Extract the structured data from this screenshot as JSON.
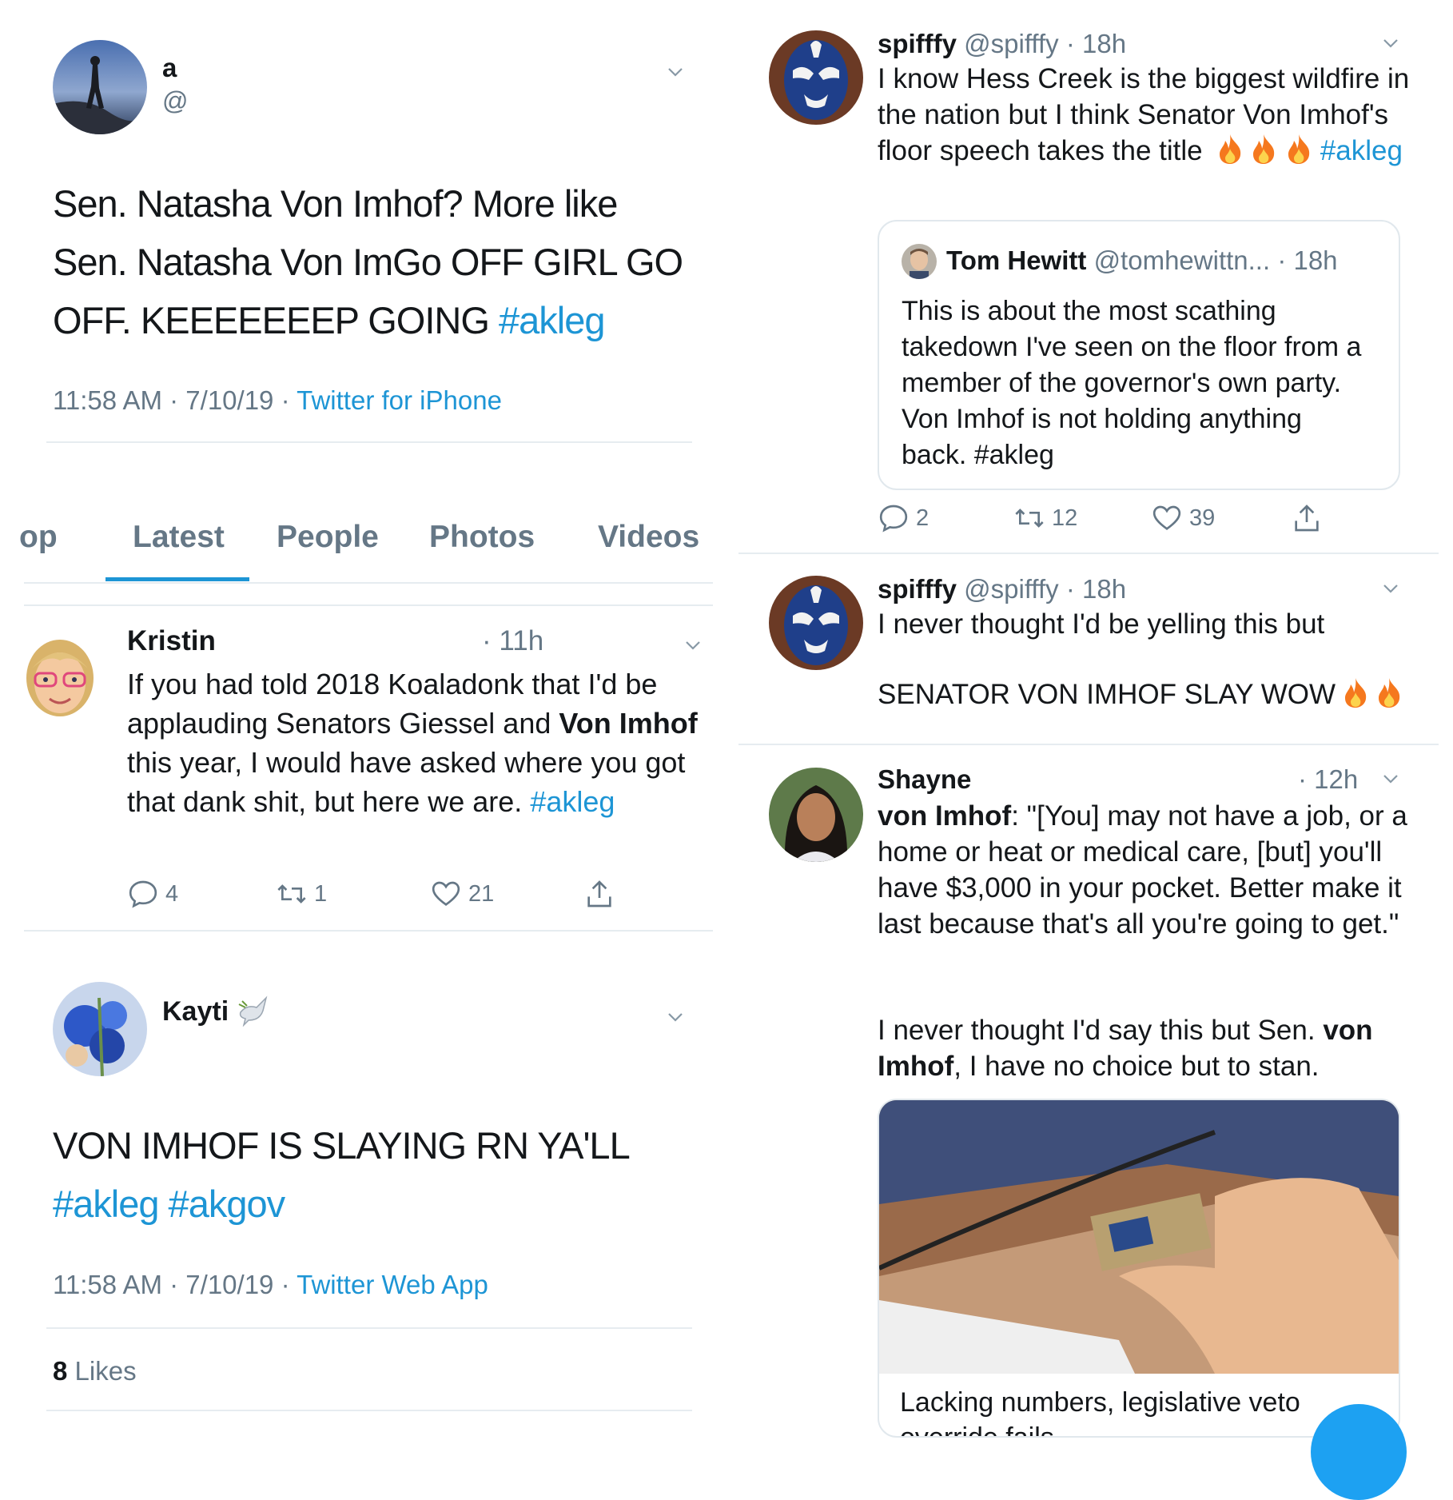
{
  "tweet1": {
    "name": "a",
    "handle": "@",
    "text": "Sen. Natasha Von Imhof? More like Sen. Natasha Von ImGo OFF GIRL GO OFF. KEEEEEEEP GOING",
    "hashtag": "#akleg",
    "time": "11:58 AM · 7/10/19 · ",
    "source": "Twitter for iPhone"
  },
  "tabs": [
    "Top",
    "Latest",
    "People",
    "Photos",
    "Videos"
  ],
  "tab_visible": [
    "op",
    "Latest",
    "People",
    "Photos",
    "Videos"
  ],
  "kristin": {
    "name": "Kristin",
    "time": "· 11h",
    "text_before": "If you had told 2018 Koaladonk that I'd be applauding Senators Giessel and ",
    "bold1": "Von Imhof",
    "text_after": " this year, I would have asked where you got that dank shit, but here we are. ",
    "hashtag": "#akleg",
    "replies": "4",
    "retweets": "1",
    "likes": "21"
  },
  "kayti": {
    "name": "Kayti",
    "text": "VON IMHOF IS SLAYING RN YA'LL",
    "hashtags": "#akleg #akgov",
    "time": "11:58 AM · 7/10/19 · ",
    "source": "Twitter Web App",
    "likes_count": "8",
    "likes_label": "Likes"
  },
  "spifffy1": {
    "name": "spifffy",
    "handle_time": "@spifffy · 18h",
    "text": "I know Hess Creek is the biggest wildfire in the nation but I think Senator Von Imhof's floor speech takes the title",
    "hashtag": "#akleg",
    "quote": {
      "name": "Tom Hewitt",
      "handle": "@tomhewittn...",
      "time": "· 18h",
      "text": "This is about the most scathing takedown I've seen on the floor from a member of the governor's own party. Von Imhof is not holding anything back. #akleg"
    },
    "replies": "2",
    "retweets": "12",
    "likes": "39"
  },
  "spifffy2": {
    "name": "spifffy",
    "handle_time": "@spifffy · 18h",
    "line1": "I never thought I'd be yelling this but",
    "line2": "SENATOR VON IMHOF SLAY WOW"
  },
  "shayne": {
    "name": "Shayne",
    "time": "· 12h",
    "bold1": "von Imhof",
    "quote_text": ": \"[You] may not have a job, or a home or heat or medical care, [but] you'll have $3,000 in your pocket. Better make it last because that's all you're going to get.\"",
    "text2_before": "I never thought I'd say this but Sen. ",
    "bold2": "von Imhof",
    "text2_after": ", I have no choice but to stan.",
    "card_title": "Lacking numbers, legislative veto override fails"
  },
  "colors": {
    "accent": "#1d95d5",
    "grey": "#657786",
    "divider": "#e6ecf0"
  }
}
